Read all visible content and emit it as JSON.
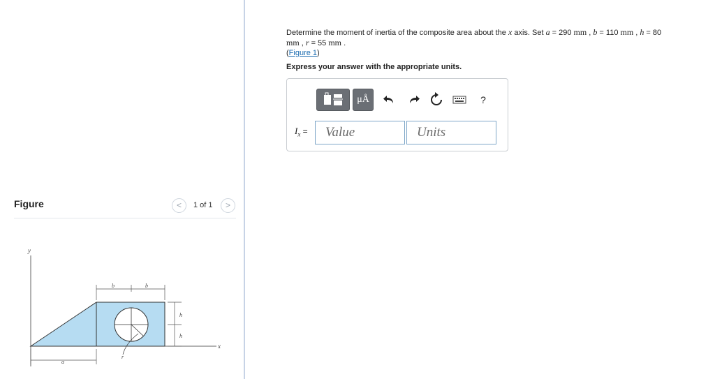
{
  "left": {
    "figure_title": "Figure",
    "pager": {
      "prev": "<",
      "indicator": "1 of 1",
      "next": ">"
    }
  },
  "figure": {
    "labels": {
      "y": "y",
      "x": "x",
      "b1": "b",
      "b2": "b",
      "h1": "h",
      "h2": "h",
      "a": "a",
      "r": "r"
    },
    "fill_color": "#b6dcf2"
  },
  "question": {
    "pre": "Determine the moment of inertia of the composite area about the ",
    "axis": "x",
    "set_text": " axis. Set ",
    "a_sym": "a",
    "a_val": " = 290 ",
    "a_unit": "mm",
    "b_sym": "b",
    "b_val": " = 110 ",
    "b_unit": "mm",
    "h_sym": "h",
    "h_val": " = 80",
    "h_unit": "mm",
    "r_sym": "r",
    "r_val": " = 55 ",
    "r_unit": "mm",
    "figure_link": "Figure 1",
    "instruction": "Express your answer with the appropriate units."
  },
  "answer": {
    "toolbar": {
      "units_label": "μÅ",
      "help_label": "?"
    },
    "label_sym": "I",
    "label_sub": "x",
    "label_eq": " =",
    "value_placeholder": "Value",
    "units_placeholder": "Units"
  }
}
